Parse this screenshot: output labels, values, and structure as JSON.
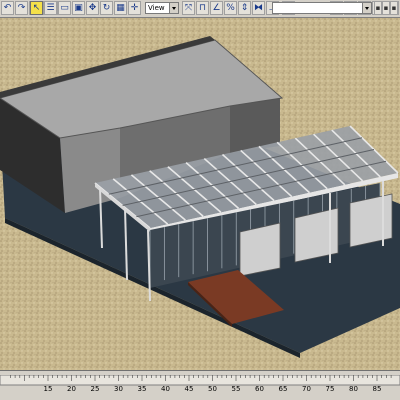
{
  "toolbar": {
    "view_combo": "View",
    "named_selection": "",
    "buttons": [
      {
        "name": "undo-icon",
        "active": false
      },
      {
        "name": "redo-icon",
        "active": false
      },
      {
        "name": "link-icon",
        "active": false
      },
      {
        "name": "unlink-icon",
        "active": false
      },
      {
        "name": "bind-space-warp-icon",
        "active": false
      },
      {
        "name": "select-object-icon",
        "active": true
      },
      {
        "name": "select-by-name-icon",
        "active": false
      },
      {
        "name": "rectangular-selection-icon",
        "active": false
      },
      {
        "name": "window-crossing-icon",
        "active": false
      },
      {
        "name": "select-and-move-icon",
        "active": false
      },
      {
        "name": "select-and-rotate-icon",
        "active": false
      },
      {
        "name": "select-and-scale-icon",
        "active": false
      },
      {
        "name": "pivot-center-icon",
        "active": false
      },
      {
        "name": "manipulate-icon",
        "active": false
      },
      {
        "name": "snaps-toggle-icon",
        "active": false
      },
      {
        "name": "angle-snap-icon",
        "active": false
      },
      {
        "name": "percent-snap-icon",
        "active": false
      },
      {
        "name": "spinner-snap-icon",
        "active": false
      },
      {
        "name": "mirror-icon",
        "active": false
      },
      {
        "name": "align-icon",
        "active": false
      },
      {
        "name": "layer-manager-icon",
        "active": false
      },
      {
        "name": "curve-editor-icon",
        "active": false
      },
      {
        "name": "schematic-view-icon",
        "active": false
      },
      {
        "name": "material-editor-icon",
        "active": false
      },
      {
        "name": "render-setup-icon",
        "active": false
      },
      {
        "name": "render-frame-icon",
        "active": false
      },
      {
        "name": "quick-render-icon",
        "active": false
      }
    ],
    "colors": {
      "active": "#f4e04a",
      "bg": "#d4d0c8"
    }
  },
  "viewport": {
    "ground_color": "#c9b98f",
    "plinth_color": "#2b3844",
    "deck_color": "#7a3a24"
  },
  "timeline": {
    "ticks": [
      15,
      20,
      25,
      30,
      35,
      40,
      45,
      50,
      55,
      60,
      65,
      70,
      75,
      80,
      85
    ]
  }
}
